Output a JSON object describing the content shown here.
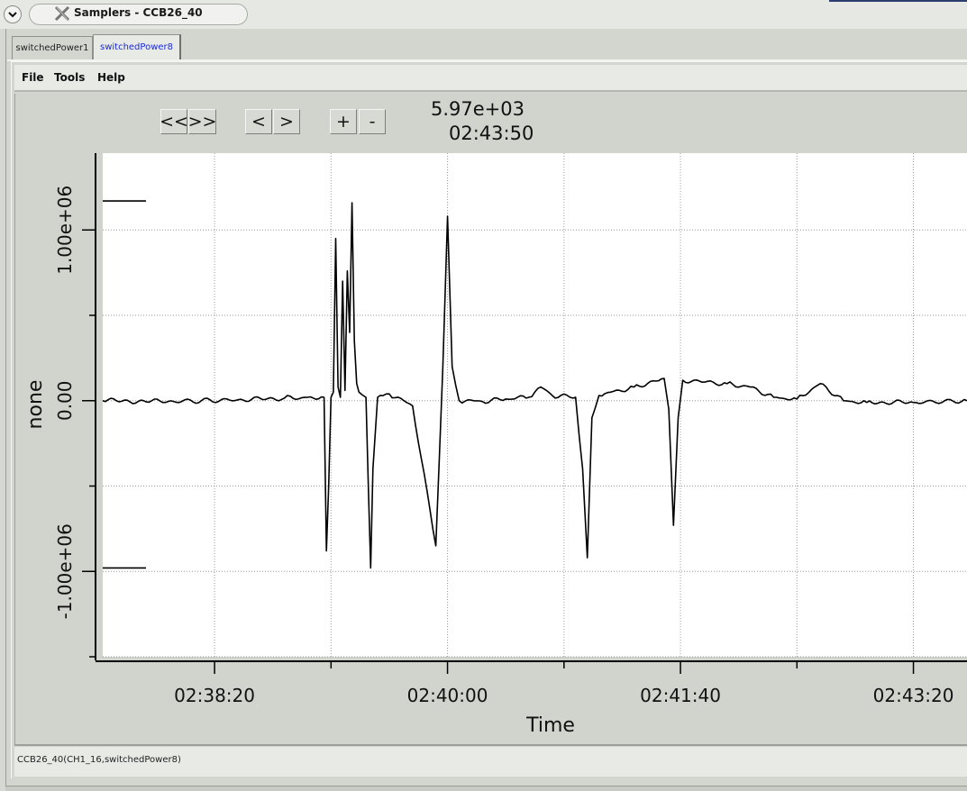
{
  "window": {
    "title": "Samplers - CCB26_40",
    "menu_icon": "chevron-down-icon",
    "app_icon": "x-logo-icon"
  },
  "tabs": [
    {
      "label": "switchedPower1",
      "active": false
    },
    {
      "label": "switchedPower8",
      "active": true
    }
  ],
  "menu": {
    "file": "File",
    "tools": "Tools",
    "help": "Help"
  },
  "nav": {
    "first": "<<",
    "last": ">>",
    "prev": "<",
    "next": ">",
    "zoom_in": "+",
    "zoom_out": "-"
  },
  "readout": {
    "value": "5.97e+03",
    "time": "02:43:50"
  },
  "status": {
    "text": "CCB26_40(CH1_16,switchedPower8)"
  },
  "colors": {
    "trace": "#000000",
    "plot_bg": "#ffffff",
    "active_tab_text": "#1b2bd6"
  },
  "chart_data": {
    "type": "line",
    "xlabel": "Time",
    "ylabel": "none",
    "x_ticks": [
      "02:38:20",
      "02:40:00",
      "02:41:40",
      "02:43:20"
    ],
    "y_ticks": [
      "1.00e+06",
      "0.00",
      "-1.00e+06"
    ],
    "ylim": [
      -1500000.0,
      1450000.0
    ],
    "xlim": [
      "02:37:32",
      "02:43:43"
    ],
    "grid": true,
    "limit_lines": [
      1170000.0,
      -980000.0
    ],
    "series": [
      {
        "x": [
          "02:37:32",
          "02:38:00",
          "02:38:30",
          "02:38:50",
          "02:39:00",
          "02:39:07",
          "02:39:08",
          "02:39:09",
          "02:39:10",
          "02:39:11",
          "02:39:12",
          "02:39:13",
          "02:39:14",
          "02:39:15",
          "02:39:16",
          "02:39:17",
          "02:39:18",
          "02:39:19",
          "02:39:20",
          "02:39:21",
          "02:39:22",
          "02:39:25",
          "02:39:26",
          "02:39:27",
          "02:39:28",
          "02:39:30",
          "02:39:31",
          "02:39:35",
          "02:39:45",
          "02:39:55",
          "02:39:58",
          "02:40:00",
          "02:40:02",
          "02:40:05",
          "02:40:15",
          "02:40:25",
          "02:40:35",
          "02:40:40",
          "02:40:45",
          "02:40:55",
          "02:40:58",
          "02:41:00",
          "02:41:02",
          "02:41:05",
          "02:41:20",
          "02:41:33",
          "02:41:35",
          "02:41:37",
          "02:41:39",
          "02:41:41",
          "02:42:00",
          "02:42:10",
          "02:42:20",
          "02:42:30",
          "02:42:40",
          "02:42:50",
          "02:43:00",
          "02:43:20",
          "02:43:43"
        ],
        "y": [
          0,
          -5000,
          5000,
          15000,
          20000,
          20000,
          -880000,
          -500000,
          20000,
          50000,
          950000,
          80000,
          20000,
          700000,
          60000,
          760000,
          400000,
          1160000,
          350000,
          100000,
          50000,
          20000,
          -500000,
          -980000,
          -400000,
          20000,
          30000,
          40000,
          -30000,
          -850000,
          200000,
          1080000,
          200000,
          0,
          -5000,
          10000,
          20000,
          80000,
          30000,
          20000,
          -400000,
          -920000,
          -100000,
          30000,
          80000,
          130000,
          -50000,
          -730000,
          -100000,
          120000,
          100000,
          80000,
          20000,
          10000,
          100000,
          0,
          -10000,
          -10000,
          0
        ]
      }
    ]
  }
}
